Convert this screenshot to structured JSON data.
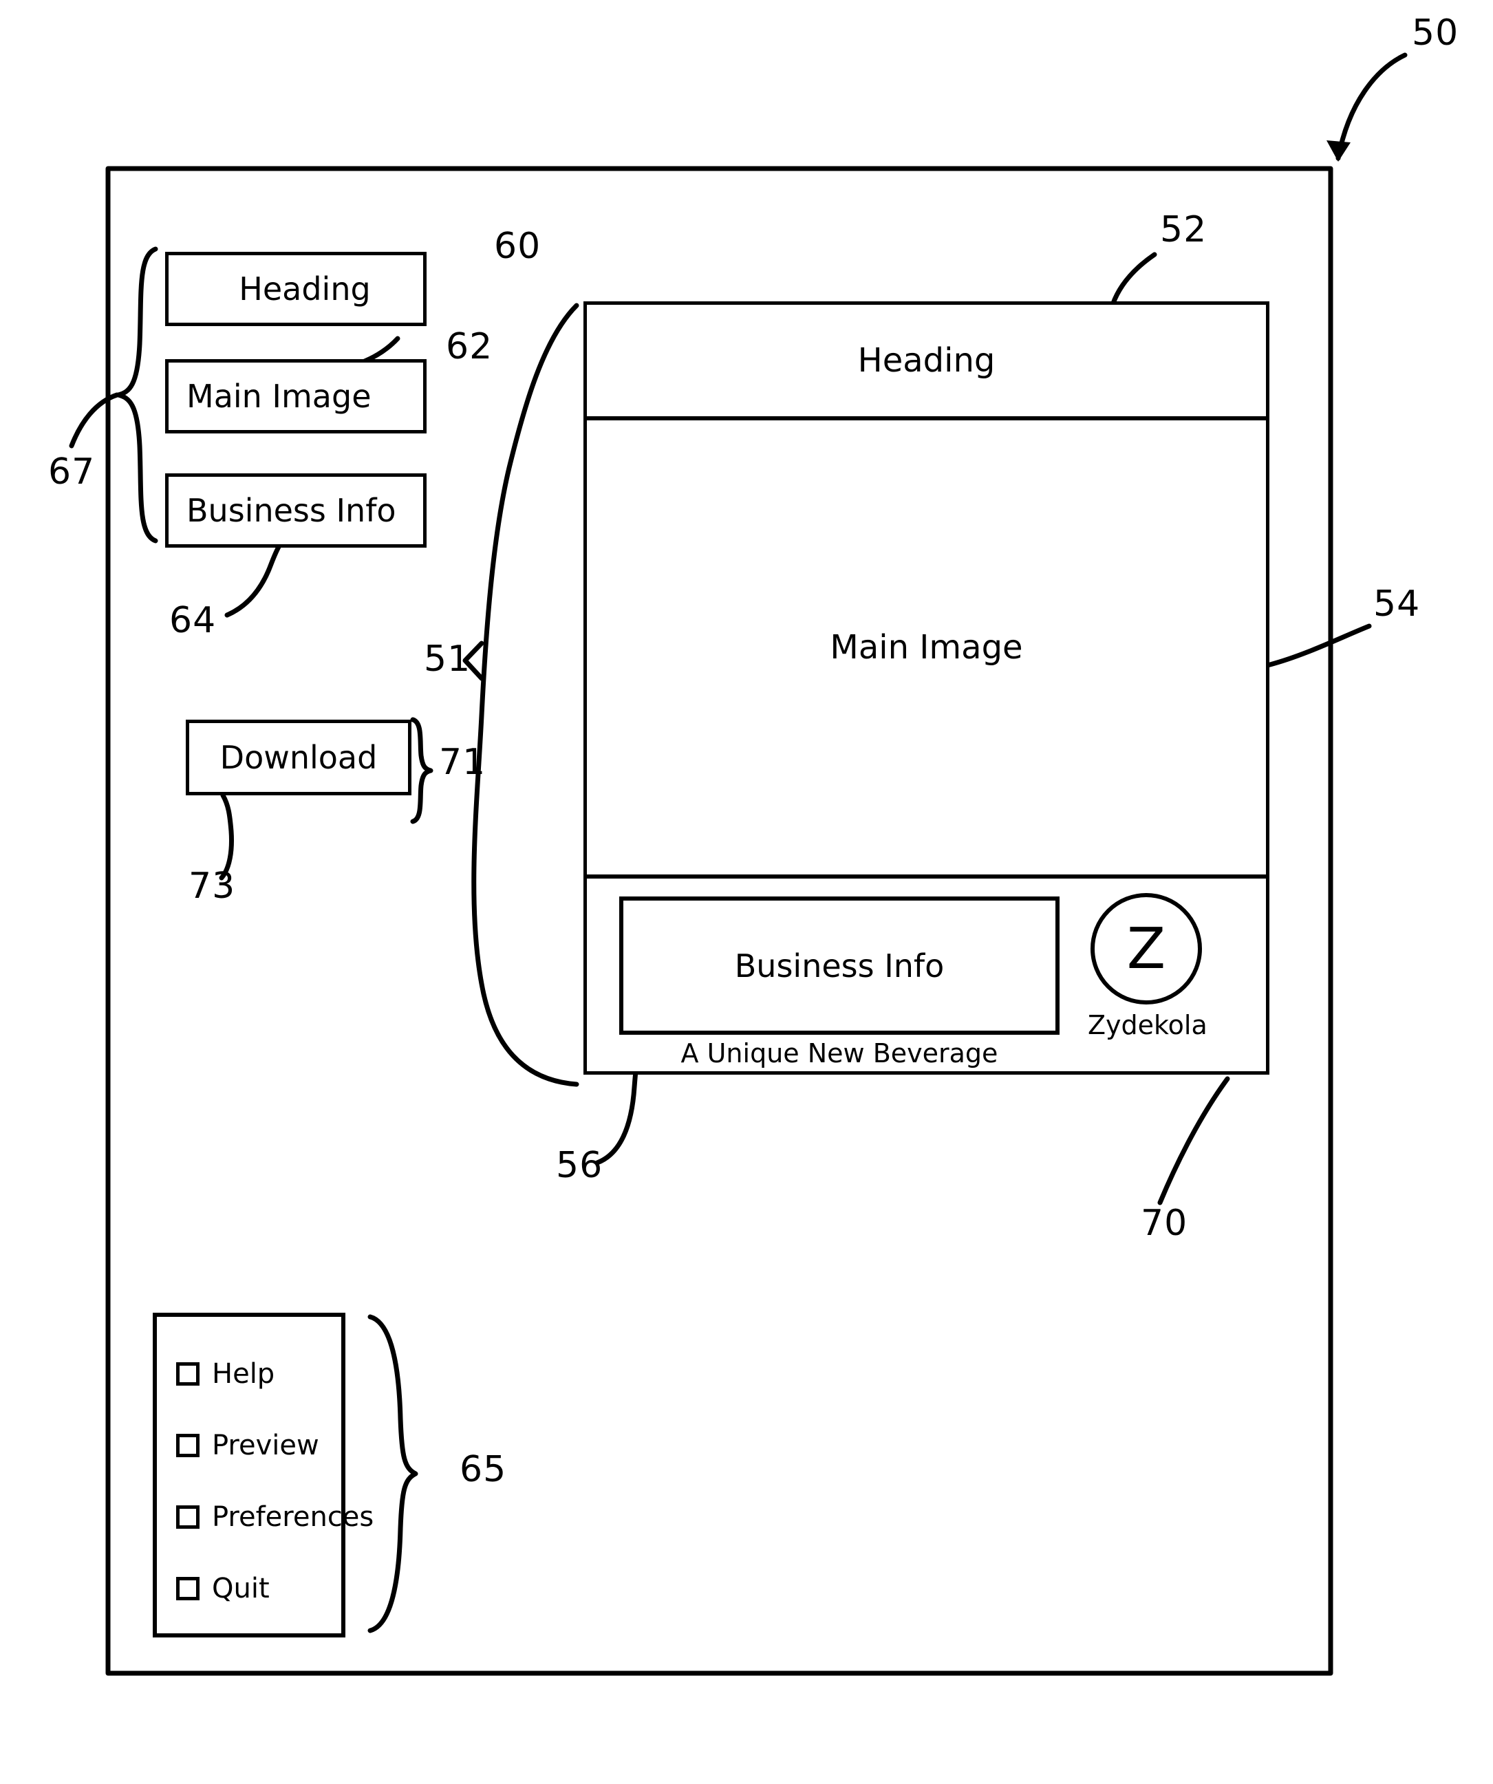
{
  "figure": {
    "frame_label": "50",
    "accent_color": "#000000",
    "background_color": "#ffffff"
  },
  "sidebar": {
    "group_label": "67",
    "items": [
      {
        "label": "Heading",
        "ref": "60"
      },
      {
        "label": "Main Image",
        "ref": "62"
      },
      {
        "label": "Business Info",
        "ref": "64"
      }
    ],
    "download": {
      "label": "Download",
      "ref_bracket": "71",
      "ref_leader": "73"
    }
  },
  "preview": {
    "ref_connector": "51",
    "heading": {
      "label": "Heading",
      "ref": "52"
    },
    "main_image": {
      "label": "Main Image",
      "ref": "54"
    },
    "footer": {
      "business_info": {
        "label": "Business Info",
        "ref": "56"
      },
      "tagline": "A Unique New Beverage",
      "brand": {
        "monogram": "Z",
        "name": "Zydekola",
        "ref": "70"
      }
    }
  },
  "menu": {
    "ref": "65",
    "items": [
      {
        "label": "Help",
        "checked": false
      },
      {
        "label": "Preview",
        "checked": false
      },
      {
        "label": "Preferences",
        "checked": false
      },
      {
        "label": "Quit",
        "checked": false
      }
    ]
  }
}
